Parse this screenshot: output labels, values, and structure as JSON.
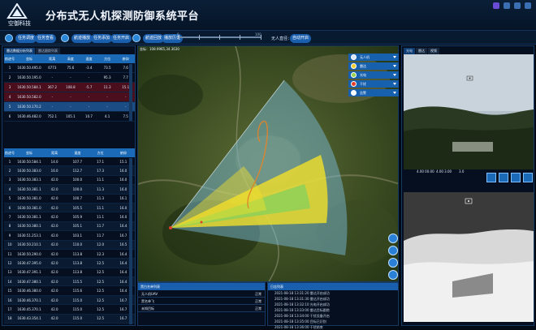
{
  "header": {
    "app_title": "分布式无人机探测防御系统平台",
    "logo_text": "空御科技"
  },
  "toolbar": {
    "buttons": [
      "任务调度",
      "任务查看",
      "航迹播放",
      "任务添加",
      "任务开启",
      "航迹回放",
      "播放历史"
    ],
    "scale_left": "0",
    "scale_right": "100",
    "drone_label": "无人直径：",
    "drone_value": "自动开启"
  },
  "left_panel": {
    "tabs": [
      "雷达数据分析列表",
      "雷达跟踪列表"
    ],
    "table1": {
      "columns": [
        "航迹号",
        "坐标",
        "距离",
        "高度",
        "速度",
        "方位",
        "俯仰"
      ],
      "rows": [
        [
          "1",
          "1630.50.495.0",
          "6773",
          "75.6",
          "-3.4",
          "73.5",
          "7.6"
        ],
        [
          "2",
          "1630.50.195.0",
          "-",
          "-",
          "-",
          "95.3",
          "7.7"
        ],
        [
          "3",
          "1630.50.584.1",
          "367.2",
          "108.8",
          "-5.7",
          "11.3",
          "15.1"
        ],
        [
          "4",
          "1630.50.582.0",
          "-",
          "-",
          "-",
          "-",
          "-"
        ],
        [
          "5",
          "1630.50.170.2",
          "-",
          "-",
          "-",
          "-",
          "-"
        ],
        [
          "6",
          "1630.46.482.0",
          "752.1",
          "105.1",
          "10.7",
          "4.1",
          "7.5"
        ]
      ]
    },
    "table2": {
      "columns": [
        "航迹号",
        "坐标",
        "距离",
        "速度",
        "方位",
        "俯仰"
      ],
      "rows": [
        [
          "1",
          "1630.50.584.1",
          "14.0",
          "107.7",
          "17.1",
          "15.1"
        ],
        [
          "2",
          "1630.50.383.0",
          "16.0",
          "112.7",
          "17.3",
          "16.0"
        ],
        [
          "3",
          "1630.50.383.1",
          "42.0",
          "100.0",
          "11.1",
          "16.0"
        ],
        [
          "4",
          "1630.50.381.1",
          "42.0",
          "100.0",
          "11.3",
          "16.0"
        ],
        [
          "5",
          "1630.50.381.0",
          "42.0",
          "100.7",
          "11.3",
          "16.1"
        ],
        [
          "6",
          "1630.50.381.0",
          "42.0",
          "105.5",
          "11.1",
          "16.0"
        ],
        [
          "7",
          "1630.50.381.1",
          "42.0",
          "105.9",
          "11.1",
          "16.0"
        ],
        [
          "8",
          "1630.50.380.1",
          "42.0",
          "105.1",
          "11.7",
          "16.4"
        ],
        [
          "9",
          "1630.51.253.1",
          "42.0",
          "103.1",
          "11.7",
          "16.7"
        ],
        [
          "10",
          "1630.50.210.1",
          "42.0",
          "110.0",
          "12.0",
          "16.5"
        ],
        [
          "11",
          "1630.50.290.0",
          "42.0",
          "113.8",
          "12.3",
          "16.4"
        ],
        [
          "12",
          "1630.47.395.0",
          "42.0",
          "113.8",
          "12.5",
          "16.4"
        ],
        [
          "13",
          "1630.47.391.1",
          "42.0",
          "113.8",
          "12.5",
          "16.4"
        ],
        [
          "14",
          "1630.47.380.1",
          "42.0",
          "115.5",
          "12.5",
          "16.4"
        ],
        [
          "15",
          "1630.46.380.0",
          "42.0",
          "115.6",
          "12.5",
          "16.4"
        ],
        [
          "16",
          "1630.46.370.1",
          "42.0",
          "115.0",
          "12.5",
          "16.7"
        ],
        [
          "17",
          "1630.45.370.1",
          "42.0",
          "115.0",
          "12.5",
          "16.7"
        ],
        [
          "18",
          "1630.43.354.1",
          "42.0",
          "115.0",
          "12.5",
          "16.7"
        ]
      ]
    }
  },
  "map": {
    "coordinate": "坐标：108.9965,34.3630"
  },
  "legend": {
    "items": [
      {
        "label": "无人机",
        "color": "#d6e6ff"
      },
      {
        "label": "雷达",
        "color": "#f3cc2b"
      },
      {
        "label": "光电",
        "color": "#9ad14a"
      },
      {
        "label": "干扰",
        "color": "#e2402a"
      },
      {
        "label": "告警",
        "color": "#ffffff"
      }
    ]
  },
  "whitelist": {
    "title": "黑白名单列表",
    "rows": [
      {
        "name": "无人机UAV",
        "status": "正常"
      },
      {
        "name": "黑名单飞",
        "status": "正常"
      },
      {
        "name": "未知目标",
        "status": "正常"
      }
    ]
  },
  "logs": {
    "title": "日志列表",
    "rows": [
      "2021-08-18 13:31:20 雷达开启成功",
      "2021-08-18 13:31:30 雷达开启成功",
      "2021-08-18 13:32:10 光电开启成功",
      "2021-08-18 13:33:00 雷达目标跟踪",
      "2021-08-18 13:34:00 干扰设备开启",
      "2021-08-18 13:35:00 目标已识别",
      "2021-08-18 13:36:00 干扰结束"
    ]
  },
  "right_panel": {
    "tabs": [
      "光电",
      "雷达",
      "视频"
    ],
    "vid1_info_left": "4.00 00.00",
    "vid1_info_mid": "4.00 3.00",
    "vid1_info_right": "3.0",
    "vid2_info_left": "4.00 00.00",
    "vid2_info_mid": "4.00 3.00",
    "vid2_info_right": "3.0"
  },
  "colors": {
    "accent": "#1a6ab7",
    "radar_yellow": "#f3e02b",
    "radar_green": "#8ad15a",
    "alert_red": "#4a0e1c"
  }
}
